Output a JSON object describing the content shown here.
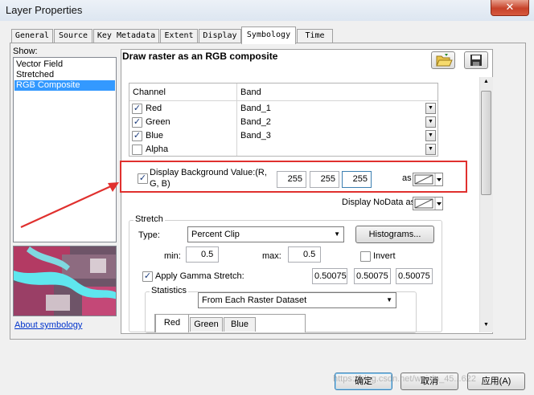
{
  "window": {
    "title": "Layer Properties",
    "close_glyph": "✕"
  },
  "tabs": [
    {
      "label": "General",
      "active": false
    },
    {
      "label": "Source",
      "active": false
    },
    {
      "label": "Key Metadata",
      "active": false
    },
    {
      "label": "Extent",
      "active": false
    },
    {
      "label": "Display",
      "active": false
    },
    {
      "label": "Symbology",
      "active": true
    },
    {
      "label": "Time",
      "active": false
    }
  ],
  "show": {
    "label": "Show:",
    "items": [
      "Vector Field",
      "Stretched",
      "RGB Composite"
    ],
    "selected_index": 2
  },
  "about_link": "About symbology",
  "heading": "Draw raster as an RGB composite",
  "toolbar": {
    "open_icon": "folder-open-icon",
    "save_icon": "save-disk-icon"
  },
  "channel_grid": {
    "headers": [
      "Channel",
      "Band"
    ],
    "rows": [
      {
        "channel": "Red",
        "band": "Band_1",
        "checked": true
      },
      {
        "channel": "Green",
        "band": "Band_2",
        "checked": true
      },
      {
        "channel": "Blue",
        "band": "Band_3",
        "checked": true
      },
      {
        "channel": "Alpha",
        "band": "",
        "checked": false
      }
    ]
  },
  "background": {
    "label": "Display Background Value:(R, G, B)",
    "checked": true,
    "r": "255",
    "g": "255",
    "b": "255",
    "as_label": "as"
  },
  "nodata": {
    "label": "Display NoData as"
  },
  "stretch": {
    "group_label": "Stretch",
    "type_label": "Type:",
    "type_value": "Percent Clip",
    "histograms_button": "Histograms...",
    "min_label": "min:",
    "min_value": "0.5",
    "max_label": "max:",
    "max_value": "0.5",
    "invert_label": "Invert",
    "invert_checked": false,
    "gamma_label": "Apply Gamma Stretch:",
    "gamma_checked": true,
    "gamma_values": [
      "0.50075",
      "0.50075",
      "0.50075"
    ]
  },
  "statistics": {
    "group_label": "Statistics",
    "source_value": "From Each Raster Dataset",
    "tabs": [
      "Red",
      "Green",
      "Blue"
    ],
    "active_tab": "Red"
  },
  "buttons": {
    "ok": "确定",
    "cancel": "取消",
    "apply": "应用(A)"
  },
  "watermark": "https://blog.csdn.net/weixin_45...622",
  "colors": {
    "highlight": "#3399ff",
    "annotation": "#e0302e",
    "link": "#0033cc"
  }
}
